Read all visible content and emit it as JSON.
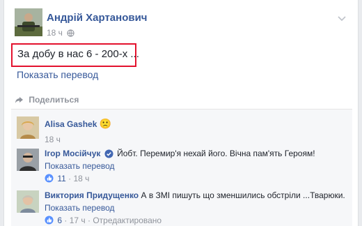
{
  "post": {
    "author": "Андрій Хартанович",
    "time": "18 ч",
    "text": "За добу в нас 6 - 200-х ...",
    "translate": "Показать перевод",
    "share": "Поделиться"
  },
  "comments": [
    {
      "author": "Alisa Gashek",
      "emoji": "🙁",
      "time": "18 ч"
    },
    {
      "author": "Ігор Мосійчук",
      "text": "Йобт. Перемир'я нехай його. Вічна пам'ять Героям!",
      "translate": "Показать перевод",
      "likes": "11",
      "time": "18 ч"
    },
    {
      "author": "Виктория Придущенко",
      "text": "А в ЗМІ пишуть що зменшились обстріли ...Тварюки.",
      "translate": "Показать перевод",
      "likes": "6",
      "time": "17 ч",
      "edited": "Отредактировано"
    }
  ]
}
